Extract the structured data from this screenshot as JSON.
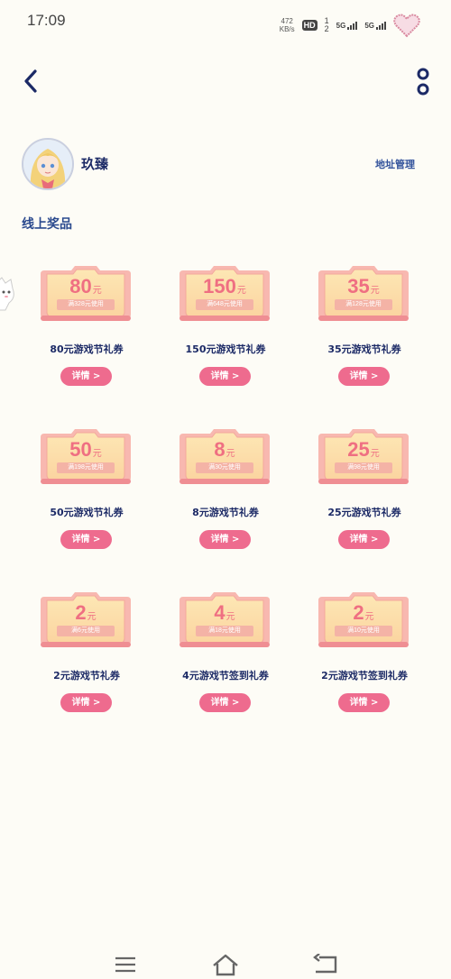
{
  "status_bar": {
    "time": "17:09",
    "net_speed_value": "472",
    "net_speed_unit": "KB/s",
    "hd_label": "HD",
    "sim_top": "1",
    "sim_bottom": "2",
    "sig1_label": "5G",
    "sig2_label": "5G"
  },
  "header": {
    "back_icon": "chevron-left-icon",
    "more_icon": "more-vertical-icon"
  },
  "profile": {
    "username": "玖臻",
    "address_link": "地址管理"
  },
  "section_title": "线上奖品",
  "prizes": [
    {
      "amount": "80",
      "unit": "元",
      "condition": "满328元使用",
      "name": "80元游戏节礼券",
      "button": "详情 >"
    },
    {
      "amount": "150",
      "unit": "元",
      "condition": "满648元使用",
      "name": "150元游戏节礼券",
      "button": "详情 >"
    },
    {
      "amount": "35",
      "unit": "元",
      "condition": "满128元使用",
      "name": "35元游戏节礼券",
      "button": "详情 >"
    },
    {
      "amount": "50",
      "unit": "元",
      "condition": "满198元使用",
      "name": "50元游戏节礼券",
      "button": "详情 >"
    },
    {
      "amount": "8",
      "unit": "元",
      "condition": "满30元使用",
      "name": "8元游戏节礼券",
      "button": "详情 >"
    },
    {
      "amount": "25",
      "unit": "元",
      "condition": "满98元使用",
      "name": "25元游戏节礼券",
      "button": "详情 >"
    },
    {
      "amount": "2",
      "unit": "元",
      "condition": "满6元使用",
      "name": "2元游戏节礼券",
      "button": "详情 >"
    },
    {
      "amount": "4",
      "unit": "元",
      "condition": "满18元使用",
      "name": "4元游戏节签到礼券",
      "button": "详情 >"
    },
    {
      "amount": "2",
      "unit": "元",
      "condition": "满10元使用",
      "name": "2元游戏节签到礼券",
      "button": "详情 >"
    }
  ],
  "nav_bar": {
    "menu_icon": "menu-icon",
    "home_icon": "home-icon",
    "back_icon": "return-icon"
  },
  "colors": {
    "background": "#fdfcf6",
    "title_text": "#1c2a66",
    "accent_pink": "#ee6b8e",
    "ticket_amount": "#ef6f82"
  }
}
